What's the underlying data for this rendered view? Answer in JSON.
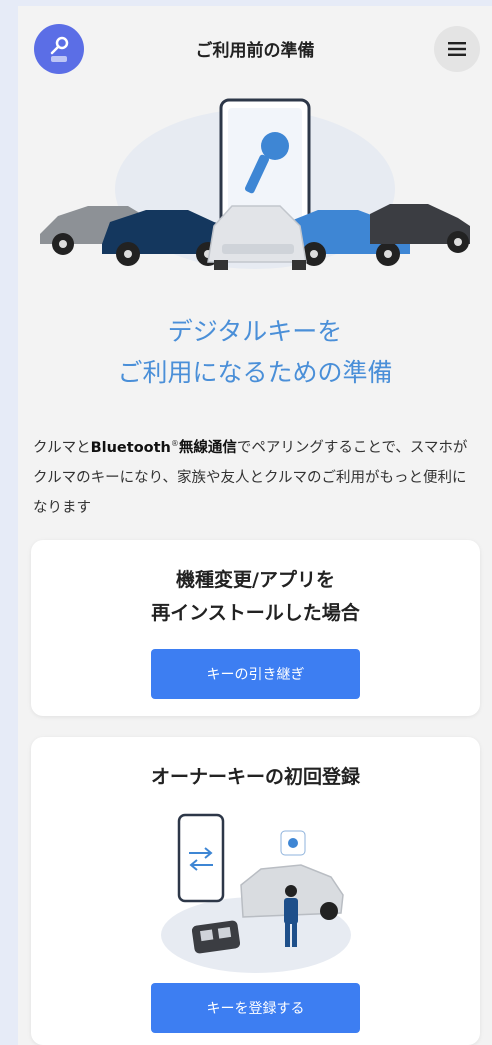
{
  "header": {
    "title": "ご利用前の準備",
    "menu_icon": "hamburger-menu-icon",
    "logo_icon": "key-car-logo-icon"
  },
  "main": {
    "heading_line1": "デジタルキーを",
    "heading_line2": "ご利用になるための準備",
    "intro": {
      "part1": "クルマと",
      "bluetooth": "Bluetooth",
      "registered": "®",
      "wireless": "無線通信",
      "part2": "でペアリングすることで、スマホがクルマのキーになり、家族や友人とクルマのご利用がもっと便利になります"
    }
  },
  "cards": {
    "transfer": {
      "title_line1": "機種変更/アプリを",
      "title_line2": "再インストールした場合",
      "button": "キーの引き継ぎ"
    },
    "register": {
      "title": "オーナーキーの初回登録",
      "button": "キーを登録する"
    }
  },
  "colors": {
    "accent_text": "#4a8fd8",
    "button": "#3d7ef2",
    "logo": "#5b6ee6"
  }
}
